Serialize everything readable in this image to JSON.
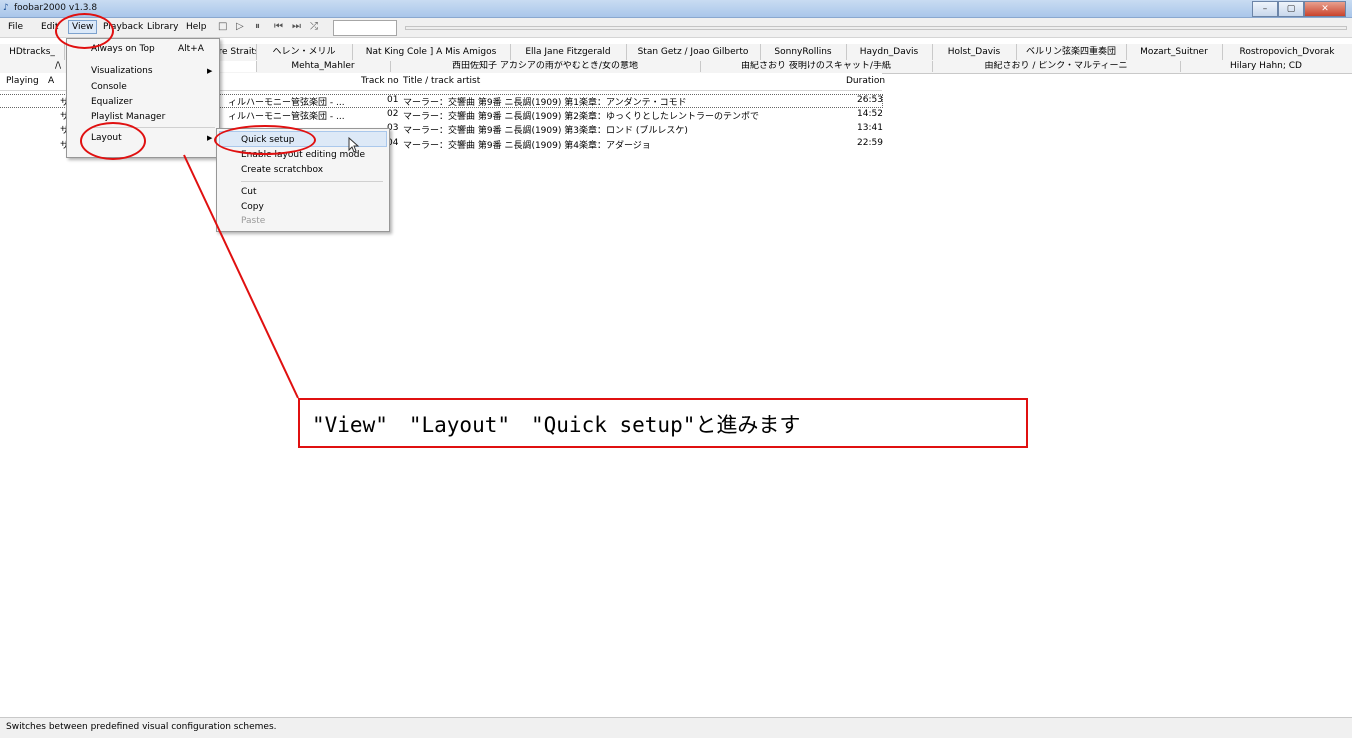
{
  "window": {
    "title": "foobar2000 v1.3.8",
    "controls": [
      "minimize",
      "maximize",
      "close"
    ]
  },
  "menubar": {
    "items": [
      {
        "label": "File",
        "key": "file"
      },
      {
        "label": "Edit",
        "key": "edit"
      },
      {
        "label": "View",
        "key": "view"
      },
      {
        "label": "Playback",
        "key": "playback"
      },
      {
        "label": "Library",
        "key": "library"
      },
      {
        "label": "Help",
        "key": "help"
      }
    ],
    "toolbar_icons": [
      "stop-icon",
      "play-icon",
      "pause-icon",
      "previous-icon",
      "next-icon",
      "random-icon"
    ]
  },
  "tabs_row1": [
    "HDtracks_",
    "ire Straits",
    "ヘレン・メリル",
    "Nat King Cole ] A Mis Amigos",
    "Ella Jane Fitzgerald",
    "Stan Getz / Joao Gilberto",
    "SonnyRollins",
    "Haydn_Davis",
    "Holst_Davis",
    "ベルリン弦楽四重奏団",
    "Mozart_Suitner",
    "Rostropovich_Dvorak"
  ],
  "tabs_row2": [
    "/\\",
    "",
    "Mehta_Mahler",
    "西田佐知子 アカシアの雨がやむとき/女の意地",
    "由紀さおり 夜明けのスキャット/手紙",
    "由紀さおり / ピンク・マルティーニ",
    "Hilary Hahn; CD"
  ],
  "playlist": {
    "columns": {
      "playing": "Playing",
      "artist": "A",
      "track_no": "Track no",
      "title": "Title / track artist",
      "duration": "Duration"
    },
    "rows": [
      {
        "artist": "サ",
        "album": "ィルハーモニー管弦楽団 - ...",
        "track_no": "01",
        "title": "マーラー：交響曲 第9番 ニ長調(1909) 第1楽章：アンダンテ・コモド",
        "duration": "26:53"
      },
      {
        "artist": "サ",
        "album": "ィルハーモニー管弦楽団 - ...",
        "track_no": "02",
        "title": "マーラー：交響曲 第9番 ニ長調(1909) 第2楽章：ゆっくりとしたレントラーのテンポで",
        "duration": "14:52"
      },
      {
        "artist": "サ",
        "album": "",
        "track_no": "03",
        "title": "マーラー：交響曲 第9番 ニ長調(1909) 第3楽章：ロンド (ブルレスケ)",
        "duration": "13:41"
      },
      {
        "artist": "サ",
        "album": "",
        "track_no": "04",
        "title": "マーラー：交響曲 第9番 ニ長調(1909) 第4楽章：アダージョ",
        "duration": "22:59"
      }
    ]
  },
  "view_menu": {
    "items": [
      {
        "label": "Always on Top",
        "shortcut": "Alt+A"
      },
      {
        "label": "Visualizations",
        "submenu": true
      },
      {
        "label": "Console"
      },
      {
        "label": "Equalizer"
      },
      {
        "label": "Playlist Manager"
      },
      {
        "label": "Layout",
        "submenu": true
      }
    ]
  },
  "layout_menu": {
    "items": [
      {
        "label": "Quick setup"
      },
      {
        "label": "Enable layout editing mode"
      },
      {
        "label": "Create scratchbox"
      },
      {
        "label": "Cut"
      },
      {
        "label": "Copy"
      },
      {
        "label": "Paste",
        "disabled": true
      }
    ]
  },
  "annotation": {
    "text": "\"View\"　\"Layout\"　\"Quick setup\"と進みます",
    "color": "#e01010"
  },
  "statusbar": {
    "text": "Switches between predefined visual configuration schemes."
  }
}
